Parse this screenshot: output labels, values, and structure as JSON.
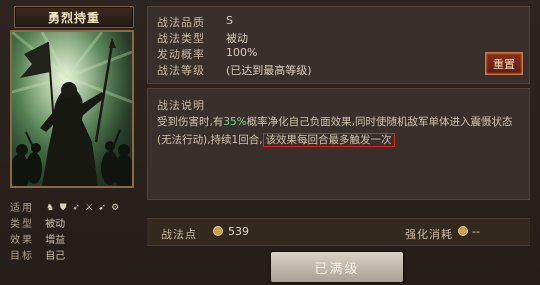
{
  "card": {
    "name": "勇烈持重"
  },
  "attrs": {
    "use_label": "适用",
    "use_icons": [
      "horse-icon",
      "shield-icon",
      "bow-icon",
      "swords-icon",
      "spear-icon",
      "wheel-icon"
    ],
    "type_label": "类型",
    "type_value": "被动",
    "effect_label": "效果",
    "effect_value": "增益",
    "target_label": "目标",
    "target_value": "自己"
  },
  "info": {
    "quality_label": "战法品质",
    "quality_value": "S",
    "type_label": "战法类型",
    "type_value": "被动",
    "rate_label": "发动概率",
    "rate_value": "100%",
    "level_label": "战法等级",
    "level_value": "(已达到最高等级)",
    "reset_button": "重置"
  },
  "description": {
    "title": "战法说明",
    "text_1": "受到伤害时,有",
    "text_highlight": "35%",
    "text_2": "概率净化自己负面效果,同时使随机敌军单体进入震慑状态(无法行动),持续1回合,",
    "text_boxed": "该效果每回合最多触发一次"
  },
  "bottom": {
    "points_label": "战法点",
    "points_value": "539",
    "enhance_label": "强化消耗",
    "enhance_value": "--",
    "max_button": "已满级"
  }
}
